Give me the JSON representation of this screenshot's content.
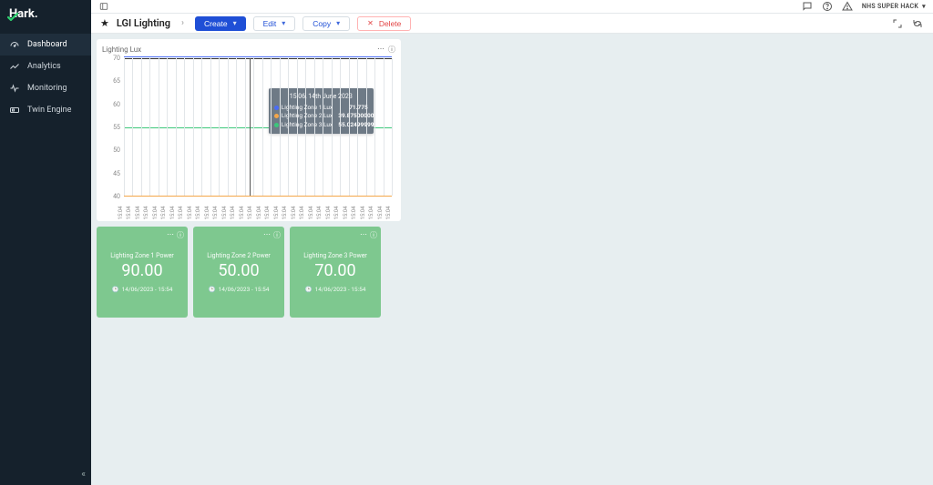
{
  "brand": {
    "name": "Hark."
  },
  "sidebar": {
    "items": [
      {
        "label": "Dashboard",
        "icon": "dashboard-icon",
        "active": true
      },
      {
        "label": "Analytics",
        "icon": "analytics-icon",
        "active": false
      },
      {
        "label": "Monitoring",
        "icon": "monitoring-icon",
        "active": false
      },
      {
        "label": "Twin Engine",
        "icon": "twin-engine-icon",
        "active": false
      }
    ]
  },
  "topbar": {
    "user_label": "NHS SUPER HACK",
    "icons": [
      "chat-icon",
      "help-icon",
      "alert-icon"
    ]
  },
  "breadcrumb": {
    "title": "LGI Lighting"
  },
  "actions": {
    "create": "Create",
    "edit": "Edit",
    "copy": "Copy",
    "delete": "Delete"
  },
  "chart_panel": {
    "title": "Lighting Lux"
  },
  "chart_data": {
    "type": "line",
    "title": "Lighting Lux",
    "ylabel": "",
    "ylim": [
      40,
      70
    ],
    "y_ticks": [
      40,
      45,
      50,
      55,
      60,
      65,
      70
    ],
    "x_tick_count": 32,
    "x_tick_label_sample": "15:04",
    "series": [
      {
        "name": "Lighting Zone 1 Lux",
        "color": "#4a6cf7",
        "value_const": 71.775
      },
      {
        "name": "Lighting Zone 2 Lux",
        "color": "#f4a64a",
        "value_const": 39.87500000000001
      },
      {
        "name": "Lighting Zone 3 Lux",
        "color": "#3cc77a",
        "value_const": 55.02499999999996
      }
    ],
    "tooltip": {
      "time_label": "15:06, 14th June 2023",
      "rows": [
        {
          "label": "Lighting Zone 1 Lux",
          "value": "71.775",
          "swatch": "blue"
        },
        {
          "label": "Lighting Zone 2 Lux",
          "value": "39.87500000000001",
          "swatch": "orange"
        },
        {
          "label": "Lighting Zone 3 Lux",
          "value": "55.02499999999996",
          "swatch": "green"
        }
      ]
    }
  },
  "cards": [
    {
      "title": "Lighting Zone 1 Power",
      "value": "90.00",
      "ts": "14/06/2023 - 15:54"
    },
    {
      "title": "Lighting Zone 2 Power",
      "value": "50.00",
      "ts": "14/06/2023 - 15:54"
    },
    {
      "title": "Lighting Zone 3 Power",
      "value": "70.00",
      "ts": "14/06/2023 - 15:54"
    }
  ]
}
